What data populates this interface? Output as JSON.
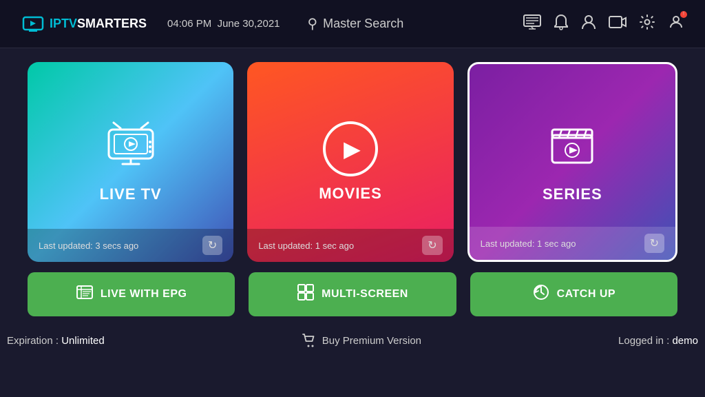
{
  "header": {
    "logo_prefix": "IPTV",
    "logo_suffix": "SMARTERS",
    "time": "04:06 PM",
    "date": "June 30,2021",
    "search_label": "Master Search"
  },
  "cards": {
    "live_tv": {
      "title": "LIVE TV",
      "footer_text": "Last updated: 3 secs ago"
    },
    "movies": {
      "title": "MOVIES",
      "footer_text": "Last updated: 1 sec ago"
    },
    "series": {
      "title": "SERIES",
      "footer_text": "Last updated: 1 sec ago"
    }
  },
  "buttons": {
    "live_epg": "LIVE WITH EPG",
    "multi_screen": "MULTI-SCREEN",
    "catch_up": "CATCH UP"
  },
  "footer": {
    "expiration_label": "Expiration : ",
    "expiration_value": "Unlimited",
    "buy_premium": "Buy Premium Version",
    "logged_in_label": "Logged in : ",
    "logged_in_value": "demo"
  }
}
